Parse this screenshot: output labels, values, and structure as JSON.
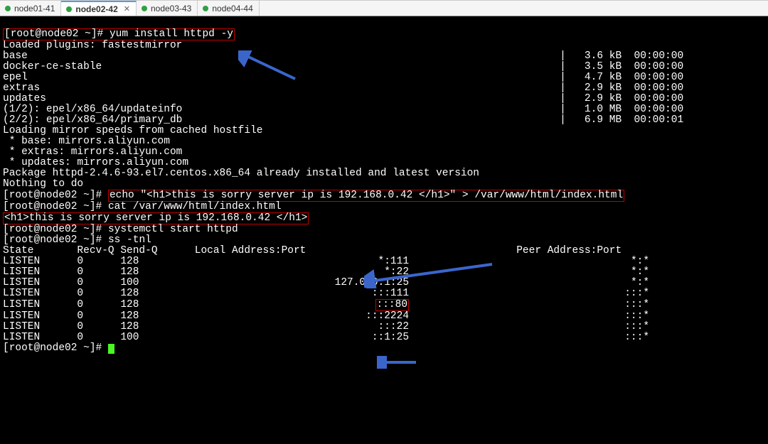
{
  "tabs": [
    {
      "label": "node01-41",
      "active": false
    },
    {
      "label": "node02-42",
      "active": true
    },
    {
      "label": "node03-43",
      "active": false
    },
    {
      "label": "node04-44",
      "active": false
    }
  ],
  "prompt": "[root@node02 ~]# ",
  "cmd_yum": "yum install httpd -y",
  "line_loaded": "Loaded plugins: fastestmirror",
  "repos": [
    {
      "name": "base",
      "size": "3.6 kB",
      "time": "00:00:00"
    },
    {
      "name": "docker-ce-stable",
      "size": "3.5 kB",
      "time": "00:00:00"
    },
    {
      "name": "epel",
      "size": "4.7 kB",
      "time": "00:00:00"
    },
    {
      "name": "extras",
      "size": "2.9 kB",
      "time": "00:00:00"
    },
    {
      "name": "updates",
      "size": "2.9 kB",
      "time": "00:00:00"
    }
  ],
  "dl": [
    {
      "label": "(1/2): epel/x86_64/updateinfo",
      "size": "1.0 MB",
      "time": "00:00:00"
    },
    {
      "label": "(2/2): epel/x86_64/primary_db",
      "size": "6.9 MB",
      "time": "00:00:01"
    }
  ],
  "mirror_hdr": "Loading mirror speeds from cached hostfile",
  "mirrors": [
    " * base: mirrors.aliyun.com",
    " * extras: mirrors.aliyun.com",
    " * updates: mirrors.aliyun.com"
  ],
  "pkg_installed": "Package httpd-2.4.6-93.el7.centos.x86_64 already installed and latest version",
  "nothing": "Nothing to do",
  "cmd_echo": "echo \"<h1>this is sorry server ip is 192.168.0.42 </h1>\" > /var/www/html/index.html",
  "cmd_cat": "cat /var/www/html/index.html",
  "cat_out": "<h1>this is sorry server ip is 192.168.0.42 </h1>",
  "cmd_start": "systemctl start httpd",
  "cmd_ss": "ss -tnl",
  "ss_hdr": {
    "state": "State",
    "recv": "Recv-Q",
    "send": "Send-Q",
    "local": "Local Address:Port",
    "peer": "Peer Address:Port"
  },
  "ss_rows": [
    {
      "state": "LISTEN",
      "recv": "0",
      "send": "128",
      "local": "*:111",
      "peer": "*:*"
    },
    {
      "state": "LISTEN",
      "recv": "0",
      "send": "128",
      "local": "*:22",
      "peer": "*:*"
    },
    {
      "state": "LISTEN",
      "recv": "0",
      "send": "100",
      "local": "127.0.0.1:25",
      "peer": "*:*"
    },
    {
      "state": "LISTEN",
      "recv": "0",
      "send": "128",
      "local": ":::111",
      "peer": ":::*"
    },
    {
      "state": "LISTEN",
      "recv": "0",
      "send": "128",
      "local": ":::80",
      "peer": ":::*"
    },
    {
      "state": "LISTEN",
      "recv": "0",
      "send": "128",
      "local": ":::2224",
      "peer": ":::*"
    },
    {
      "state": "LISTEN",
      "recv": "0",
      "send": "128",
      "local": ":::22",
      "peer": ":::*"
    },
    {
      "state": "LISTEN",
      "recv": "0",
      "send": "100",
      "local": "::1:25",
      "peer": ":::*"
    }
  ],
  "highlight_row_index": 4,
  "colors": {
    "red": "#c00000",
    "arrow": "#3a66cc",
    "green_dot": "#2ea043"
  }
}
